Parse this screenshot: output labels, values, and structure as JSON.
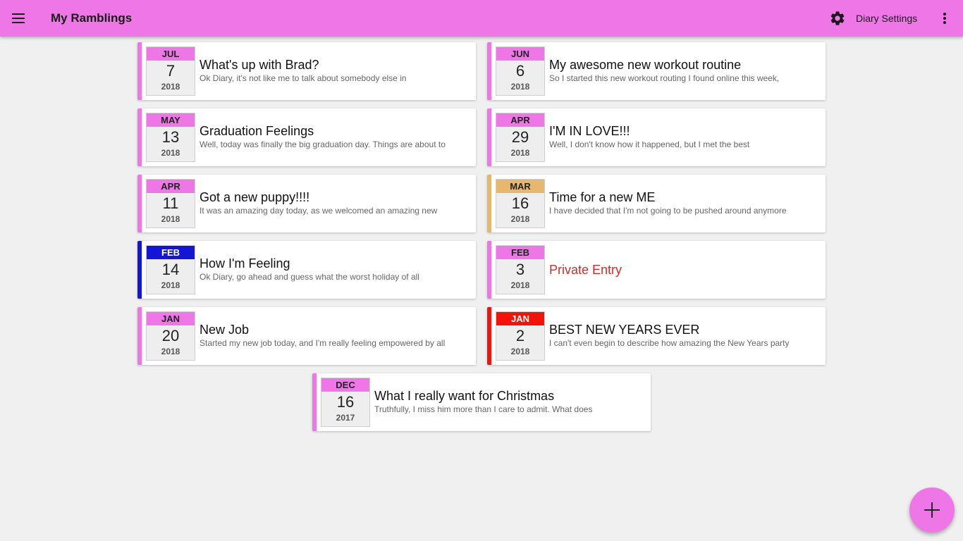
{
  "header": {
    "title": "My Ramblings",
    "settings_label": "Diary Settings",
    "menu_icon": "menu-icon",
    "settings_icon": "gear-icon",
    "more_icon": "more-vertical-icon",
    "bar_color": "#ee76e6"
  },
  "entries": [
    {
      "month": "JUL",
      "day": "7",
      "year": "2018",
      "title": "What's up with Brad?",
      "snippet": "Ok Diary, it's not like me to talk about somebody else in",
      "color": "#ee76e6"
    },
    {
      "month": "JUN",
      "day": "6",
      "year": "2018",
      "title": "My awesome new workout routine",
      "snippet": "So I started this new workout routing I found online this week,",
      "color": "#ee76e6"
    },
    {
      "month": "MAY",
      "day": "13",
      "year": "2018",
      "title": "Graduation Feelings",
      "snippet": "Well, today was finally the big graduation day.  Things are about to",
      "color": "#ee76e6"
    },
    {
      "month": "APR",
      "day": "29",
      "year": "2018",
      "title": "I'M IN LOVE!!!",
      "snippet": "Well, I don't know how it happened, but I met the best",
      "color": "#ee76e6"
    },
    {
      "month": "APR",
      "day": "11",
      "year": "2018",
      "title": "Got a new puppy!!!!",
      "snippet": "It was an amazing day today, as we welcomed an amazing new",
      "color": "#ee76e6"
    },
    {
      "month": "MAR",
      "day": "16",
      "year": "2018",
      "title": "Time for a new ME",
      "snippet": "I have decided that I'm not going to be pushed around anymore",
      "color": "#e8b76e"
    },
    {
      "month": "FEB",
      "day": "14",
      "year": "2018",
      "title": "How I'm Feeling",
      "snippet": "Ok Diary, go ahead and guess what the worst holiday of all",
      "color": "#1515d6",
      "light_text": true
    },
    {
      "month": "FEB",
      "day": "3",
      "year": "2018",
      "title": "Private Entry",
      "snippet": "",
      "color": "#ee76e6",
      "private": true
    },
    {
      "month": "JAN",
      "day": "20",
      "year": "2018",
      "title": "New Job",
      "snippet": "Started my new job today, and I'm really feeling empowered by all",
      "color": "#ee76e6"
    },
    {
      "month": "JAN",
      "day": "2",
      "year": "2018",
      "title": "BEST NEW YEARS EVER",
      "snippet": "I can't even begin to describe how amazing the New Years party",
      "color": "#f2140a",
      "light_text": true
    },
    {
      "month": "DEC",
      "day": "16",
      "year": "2017",
      "title": "What I really want for Christmas",
      "snippet": "Truthfully, I miss him more than I care to admit.  What does",
      "color": "#ee76e6"
    }
  ],
  "fab": {
    "icon": "plus-icon",
    "color": "#ee76e6"
  }
}
